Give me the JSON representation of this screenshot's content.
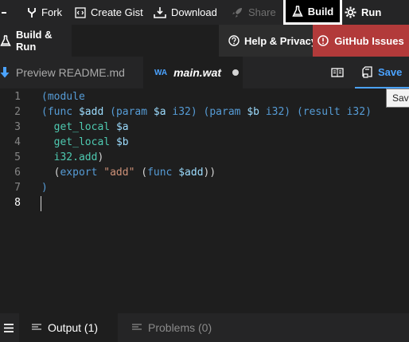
{
  "toolbar": {
    "fork_label": "Fork",
    "create_gist_label": "Create Gist",
    "download_label": "Download",
    "share_label": "Share",
    "build_label": "Build",
    "run_label": "Run"
  },
  "secondary_bar": {
    "build_run_label": "Build & Run",
    "help_label": "Help & Privacy",
    "github_issues_label": "GitHub Issues"
  },
  "tabs": {
    "readme_label": "Preview README.md",
    "main_prefix": "WA",
    "main_label": "main.wat",
    "save_label": "Save"
  },
  "tooltip": {
    "text": "Save"
  },
  "editor": {
    "line_numbers": [
      "1",
      "2",
      "3",
      "4",
      "5",
      "6",
      "7",
      "8"
    ],
    "active_line": "8",
    "lines": [
      "(module",
      "(func $add (param $a i32) (param $b i32) (result i32)",
      "  get_local $a",
      "  get_local $b",
      "  i32.add)",
      "  (export \"add\" (func $add))",
      ")",
      ""
    ]
  },
  "statusbar": {
    "output_label": "Output (1)",
    "problems_label": "Problems (0)"
  },
  "colors": {
    "accent": "#4ba3ff",
    "github_issues_bg": "#b23a3a",
    "keyword": "#569cd6",
    "variable": "#9cdcfe",
    "instruction": "#4ec9b0",
    "string": "#ce9178"
  },
  "icons": {
    "fork": "fork-icon",
    "create_gist": "code-icon",
    "download": "download-icon",
    "share": "rocket-icon",
    "build": "flask-icon",
    "run": "gear-icon",
    "build_run": "flask-icon",
    "help": "question-circle-icon",
    "github_issues": "alert-circle-icon",
    "readme": "arrow-down-icon",
    "preview": "book-icon",
    "save": "save-icon",
    "menu": "hamburger-menu-icon",
    "output": "list-icon",
    "problems": "list-icon"
  }
}
